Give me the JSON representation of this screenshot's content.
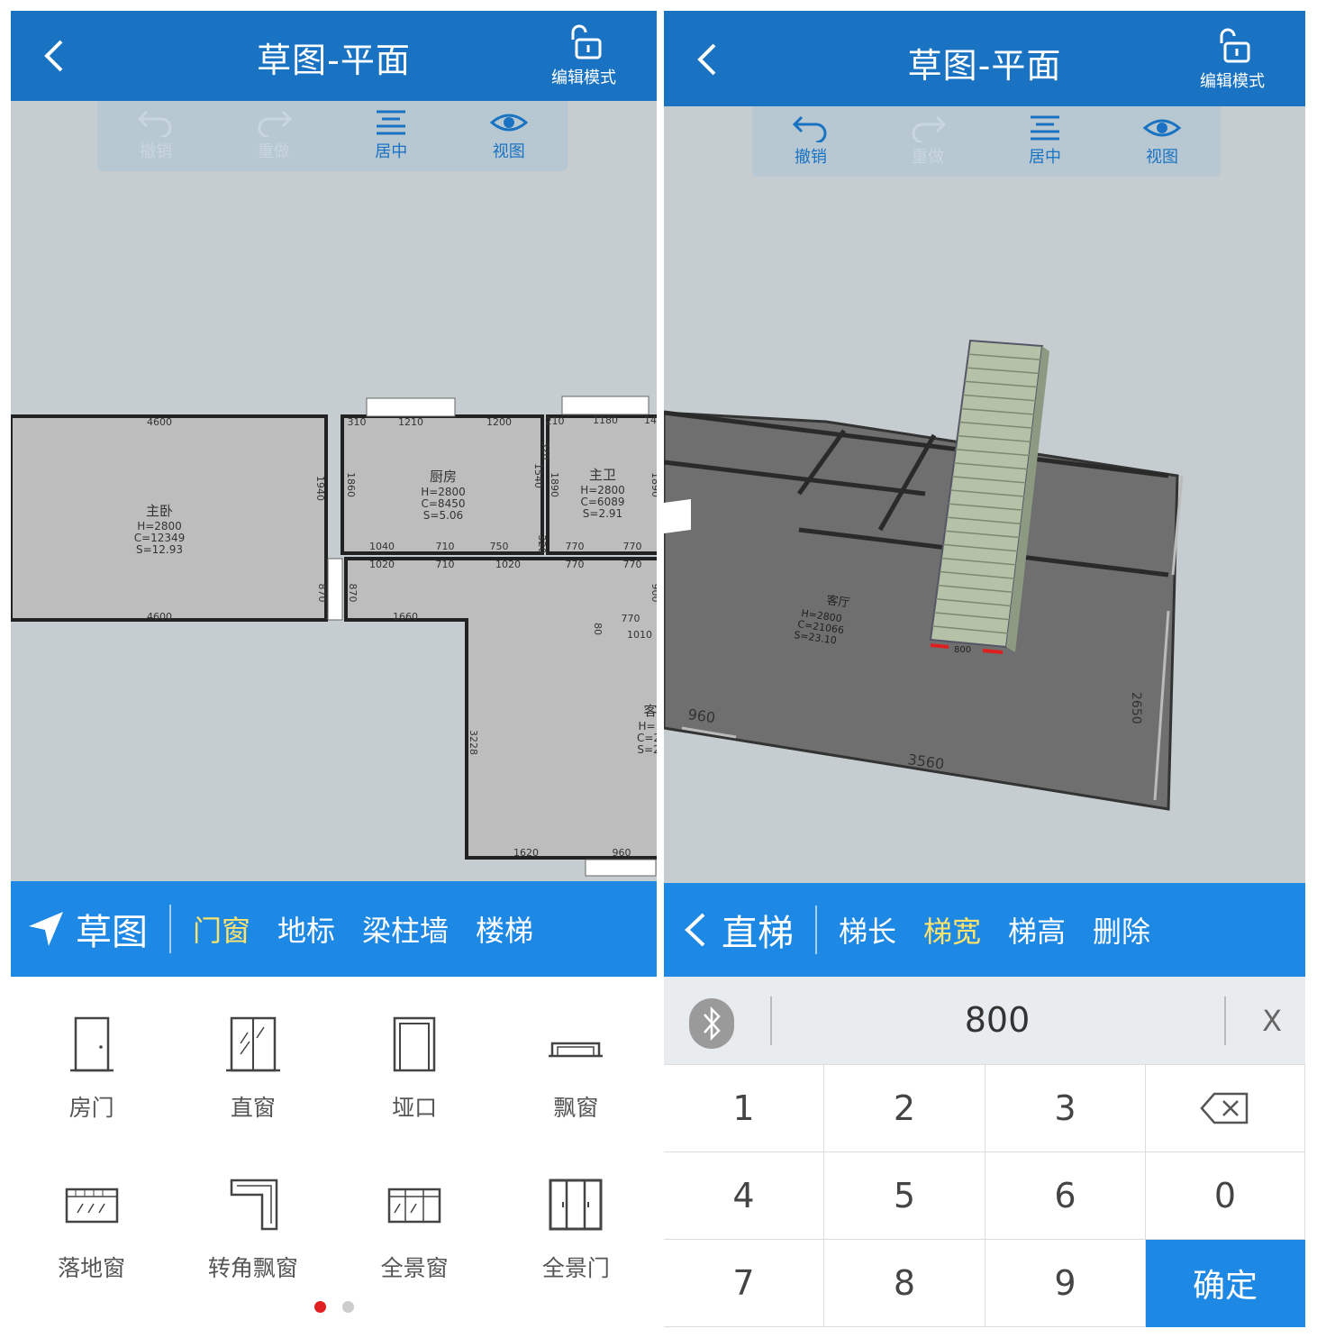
{
  "left": {
    "title": "草图-平面",
    "lock_label": "编辑模式",
    "toolbar": [
      {
        "label": "撤销",
        "icon": "undo-icon",
        "state": "disabled"
      },
      {
        "label": "重做",
        "icon": "redo-icon",
        "state": "disabled"
      },
      {
        "label": "居中",
        "icon": "center-icon",
        "state": "active"
      },
      {
        "label": "视图",
        "icon": "eye-icon",
        "state": "active"
      }
    ],
    "plan": {
      "rooms": [
        {
          "name": "主卧",
          "h": "H=2800",
          "c": "C=12349",
          "s": "S=12.93"
        },
        {
          "name": "厨房",
          "h": "H=2800",
          "c": "C=8450",
          "s": "S=5.06"
        },
        {
          "name": "主卫",
          "h": "H=2800",
          "c": "C=6089",
          "s": "S=2.91"
        },
        {
          "name": "客",
          "h": "H=:",
          "c": "C=2",
          "s": "S=2"
        }
      ],
      "dims": [
        "4600",
        "310",
        "1210",
        "1200",
        "210",
        "1180",
        "14",
        "1940",
        "1860",
        "1540",
        "1890",
        "1890",
        "1040",
        "710",
        "750",
        "320",
        "770",
        "770",
        "1020",
        "710",
        "1020",
        "770",
        "770",
        "870",
        "870",
        "900",
        "4600",
        "1660",
        "80",
        "770",
        "1010",
        "3228",
        "1620",
        "960",
        "320"
      ]
    },
    "tabbar": {
      "main": "草图",
      "tabs": [
        "门窗",
        "地标",
        "梁柱墙",
        "楼梯"
      ],
      "selected": 0
    },
    "items": [
      {
        "label": "房门",
        "icon": "door-icon"
      },
      {
        "label": "直窗",
        "icon": "window-icon"
      },
      {
        "label": "垭口",
        "icon": "opening-icon"
      },
      {
        "label": "飘窗",
        "icon": "bay-window-icon"
      },
      {
        "label": "落地窗",
        "icon": "french-window-icon"
      },
      {
        "label": "转角飘窗",
        "icon": "corner-bay-window-icon"
      },
      {
        "label": "全景窗",
        "icon": "panoramic-window-icon"
      },
      {
        "label": "全景门",
        "icon": "panoramic-door-icon"
      }
    ],
    "page_dots": {
      "count": 2,
      "active": 0
    }
  },
  "right": {
    "title": "草图-平面",
    "lock_label": "编辑模式",
    "toolbar": [
      {
        "label": "撤销",
        "icon": "undo-icon",
        "state": "active"
      },
      {
        "label": "重做",
        "icon": "redo-icon",
        "state": "disabled"
      },
      {
        "label": "居中",
        "icon": "center-icon",
        "state": "active"
      },
      {
        "label": "视图",
        "icon": "eye-icon",
        "state": "active"
      }
    ],
    "scene": {
      "stair_width_label": "800",
      "dims": [
        "960",
        "3560",
        "2650"
      ],
      "room_label": {
        "name": "客厅",
        "h": "H=2800",
        "c": "C=21066",
        "s": "S=23.10"
      }
    },
    "tabbar": {
      "main": "直梯",
      "tabs": [
        "梯长",
        "梯宽",
        "梯高",
        "删除"
      ],
      "selected": 1
    },
    "input": {
      "value": "800",
      "clear": "X"
    },
    "keys": [
      "1",
      "2",
      "3",
      "⌫",
      "4",
      "5",
      "6",
      "0",
      "7",
      "8",
      "9",
      "确定"
    ]
  },
  "colors": {
    "header": "#1a73c2",
    "tabbar": "#1e88e5",
    "selected_tab": "#ffe36a",
    "canvas": "#c5cdd0"
  }
}
